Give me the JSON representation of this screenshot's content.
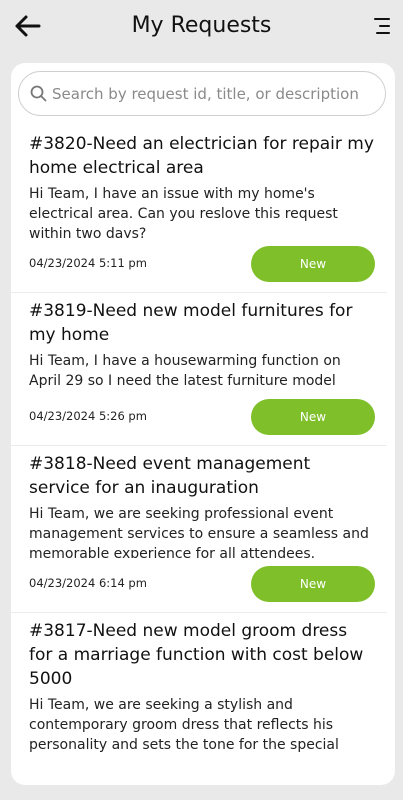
{
  "header": {
    "title": "My Requests"
  },
  "search": {
    "placeholder": "Search by request id, title, or description"
  },
  "status_color": "#7fbf2a",
  "requests": [
    {
      "title": "#3820-Need an electrician for repair my home electrical area",
      "description": "Hi Team, I have an issue with my home's electrical area. Can you reslove this request within two days?",
      "date": "04/23/2024 5:11 pm",
      "status": "New"
    },
    {
      "title": "#3819-Need new model furnitures for my home",
      "description": "Hi Team, I have a housewarming function on April 29 so I need the latest furniture model",
      "date": "04/23/2024 5:26 pm",
      "status": "New"
    },
    {
      "title": "#3818-Need event management service for an inauguration",
      "description": "Hi Team, we are seeking professional event management services to ensure a seamless and memorable experience for all attendees.",
      "date": "04/23/2024 6:14 pm",
      "status": "New"
    },
    {
      "title": "#3817-Need new model groom dress for a marriage function with cost below 5000",
      "description": "Hi Team, we are seeking a stylish and contemporary groom dress that reflects his personality and sets the tone for the special"
    }
  ]
}
